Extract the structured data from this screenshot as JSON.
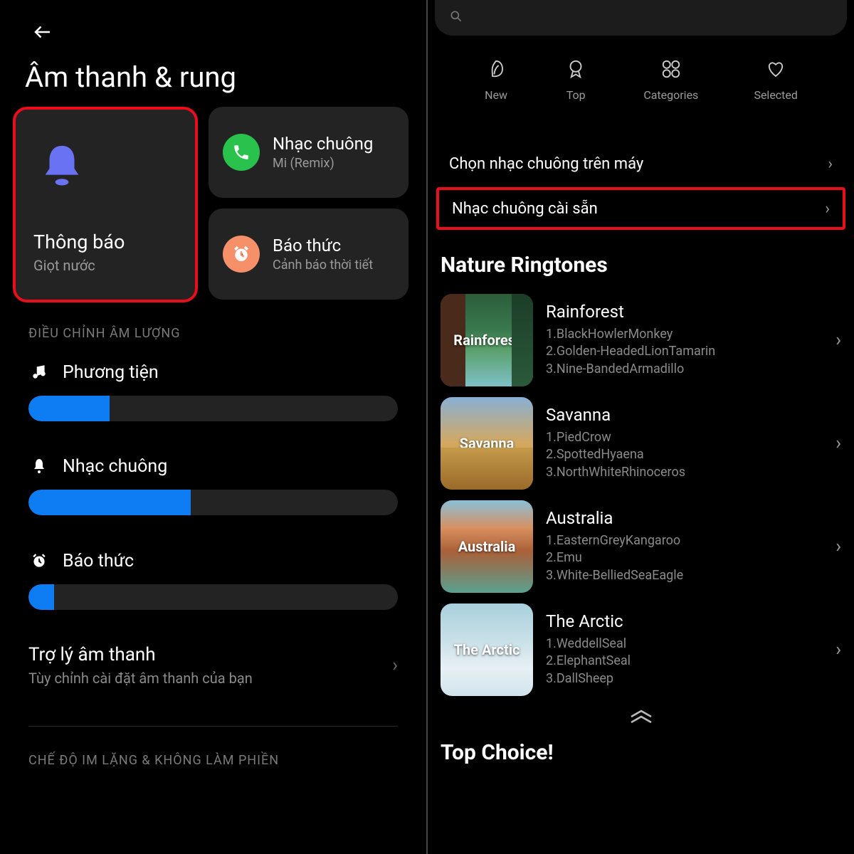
{
  "left": {
    "page_title": "Âm thanh & rung",
    "notification_card": {
      "title": "Thông báo",
      "subtitle": "Giọt nước"
    },
    "ringtone_card": {
      "title": "Nhạc chuông",
      "subtitle": "Mi (Remix)"
    },
    "alarm_card": {
      "title": "Báo thức",
      "subtitle": "Cảnh báo thời tiết"
    },
    "volume_section_label": "ĐIỀU CHỈNH ÂM LƯỢNG",
    "sliders": {
      "media": {
        "label": "Phương tiện",
        "percent": 22
      },
      "ringtone": {
        "label": "Nhạc chuông",
        "percent": 44
      },
      "alarm": {
        "label": "Báo thức",
        "percent": 7
      }
    },
    "assistant": {
      "title": "Trợ lý âm thanh",
      "subtitle": "Tùy chỉnh cài đặt âm thanh của bạn"
    },
    "dnd_section_label": "CHẾ ĐỘ IM LẶNG & KHÔNG LÀM PHIỀN"
  },
  "right": {
    "tabs": {
      "new": "New",
      "top": "Top",
      "categories": "Categories",
      "selected": "Selected"
    },
    "row_local": "Chọn nhạc chuông trên máy",
    "row_preinstalled": "Nhạc chuông cài sẵn",
    "nature_title": "Nature Ringtones",
    "ringtones": [
      {
        "name": "Rainforest",
        "tracks": [
          "1.BlackHowlerMonkey",
          "2.Golden-HeadedLionTamarin",
          "3.Nine-BandedArmadillo"
        ]
      },
      {
        "name": "Savanna",
        "tracks": [
          "1.PiedCrow",
          "2.SpottedHyaena",
          "3.NorthWhiteRhinoceros"
        ]
      },
      {
        "name": "Australia",
        "tracks": [
          "1.EasternGreyKangaroo",
          "2.Emu",
          "3.White-BelliedSeaEagle"
        ]
      },
      {
        "name": "The Arctic",
        "tracks": [
          "1.WeddellSeal",
          "2.ElephantSeal",
          "3.DallSheep"
        ]
      }
    ],
    "top_choice": "Top Choice!"
  }
}
